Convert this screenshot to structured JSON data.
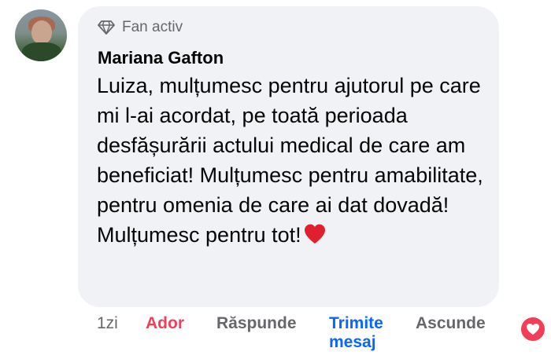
{
  "comment": {
    "badge_label": "Fan activ",
    "author": "Mariana Gafton",
    "text": "Luiza, mulțumesc pentru ajutorul pe care mi l-ai acordat, pe toată perioada desfășurării actului medical de care am beneficiat! Mulțumesc pentru amabilitate, pentru omenia de care ai dat dovadă! Mulțumesc pentru tot!",
    "emoji": "red-heart",
    "avatar": "user-avatar-photo"
  },
  "actions": {
    "time": "1zi",
    "reaction_label": "Ador",
    "reply_label": "Răspunde",
    "send_message_line1": "Trimite",
    "send_message_line2": "mesaj",
    "hide_label": "Ascunde"
  },
  "reactions": {
    "icon": "heart-reaction-icon"
  },
  "colors": {
    "bubble_bg": "#f0f2f5",
    "ador": "#f33e58",
    "link_blue": "#0866ff",
    "muted": "#65676b",
    "heart_red": "#f33e58"
  }
}
